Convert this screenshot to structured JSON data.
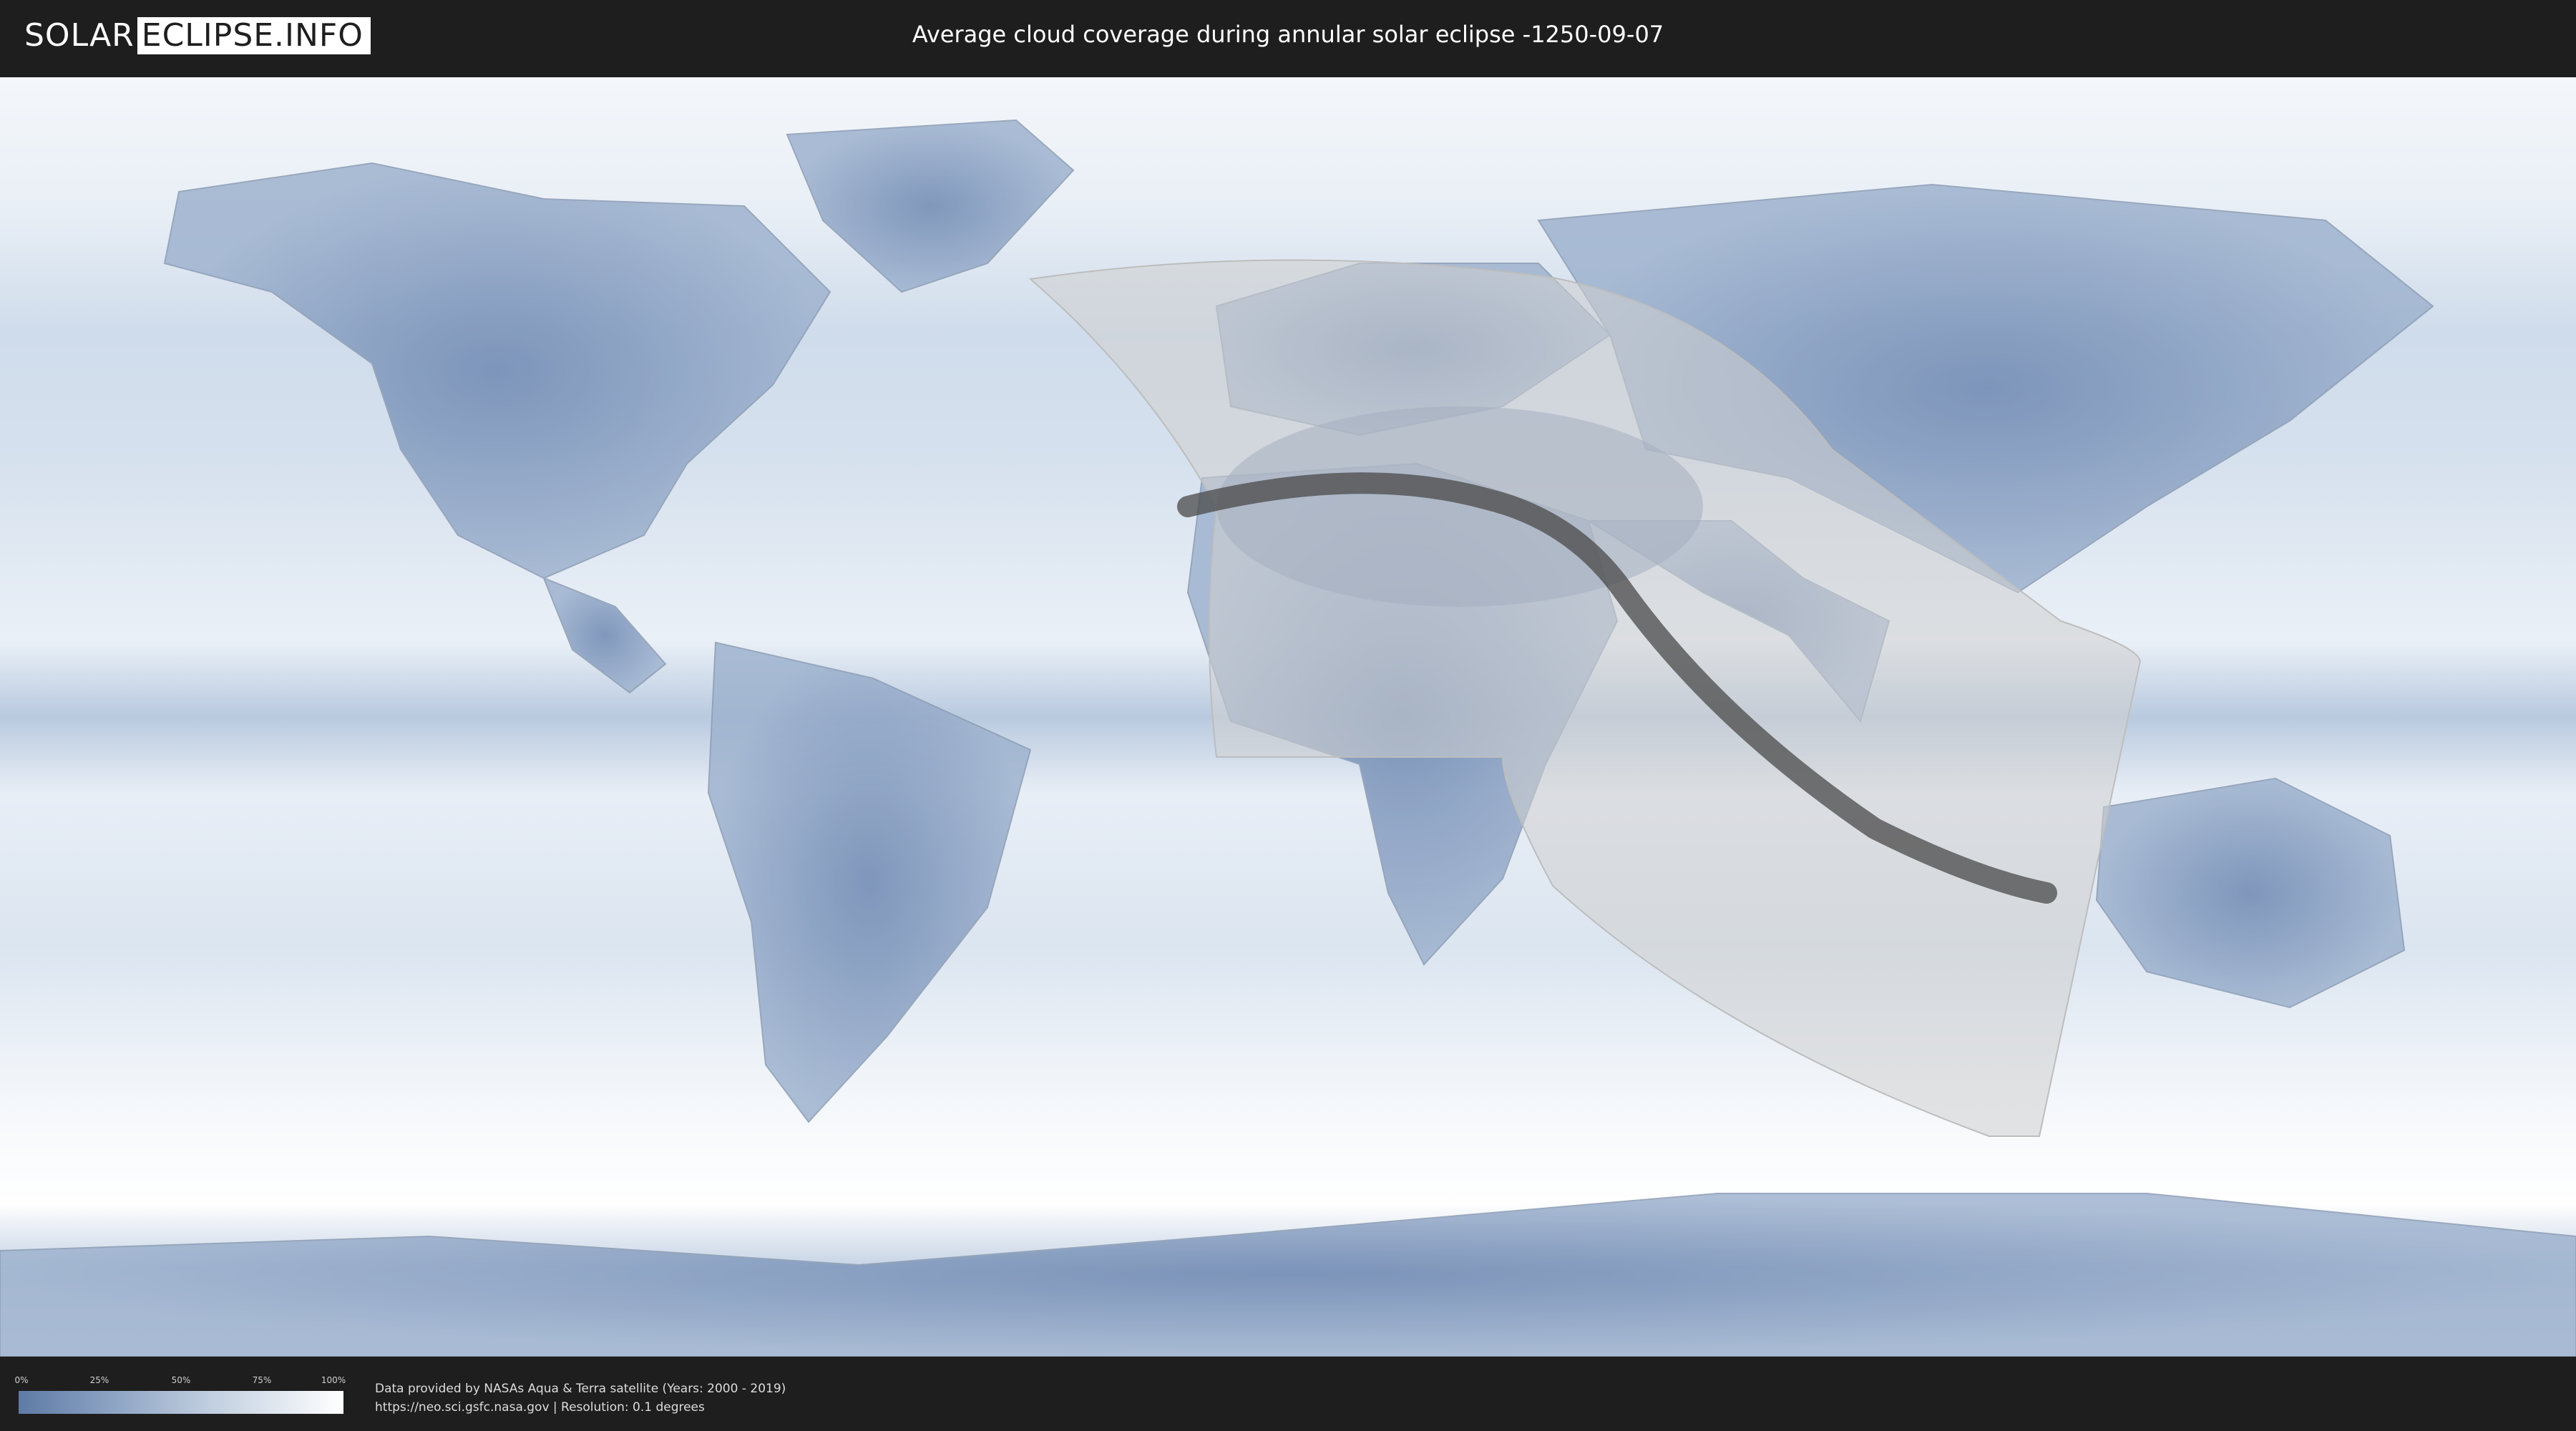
{
  "header": {
    "logo_left": "SOLAR",
    "logo_right": "ECLIPSE.INFO",
    "title": "Average cloud coverage during annular solar eclipse -1250-09-07"
  },
  "legend": {
    "ticks": [
      "0%",
      "25%",
      "50%",
      "75%",
      "100%"
    ],
    "colors": {
      "low": "#5e7aa6",
      "high": "#ffffff"
    }
  },
  "footer": {
    "credit_line1": "Data provided by NASAs Aqua & Terra satellite (Years: 2000 - 2019)",
    "credit_line2": "https://neo.sci.gsfc.nasa.gov | Resolution: 0.1 degrees"
  },
  "colors": {
    "background": "#1e1e1e",
    "cloud_light": "#f2f6fa",
    "cloud_dark": "#5e7aa6",
    "eclipse_zone": "#c8c8c8",
    "eclipse_path": "#4a4a4a"
  }
}
